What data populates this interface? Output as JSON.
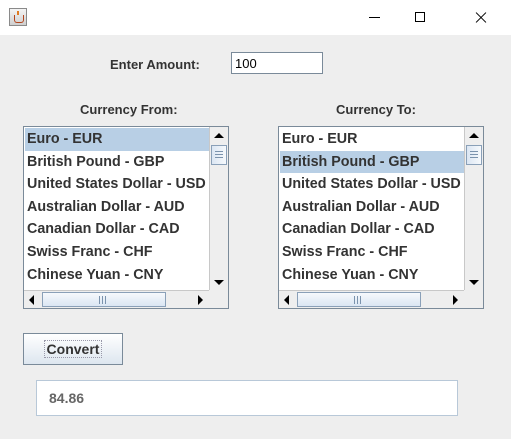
{
  "window": {
    "title": ""
  },
  "form": {
    "amount_label": "Enter Amount:",
    "amount_value": "100",
    "from_label": "Currency From:",
    "to_label": "Currency To:",
    "currencies": [
      "Euro - EUR",
      "British Pound - GBP",
      "United States Dollar - USD",
      "Australian Dollar - AUD",
      "Canadian Dollar - CAD",
      "Swiss Franc - CHF",
      "Chinese Yuan - CNY"
    ],
    "from_selected": "Euro - EUR",
    "to_selected": "British Pound - GBP",
    "convert_label": "Convert",
    "result": "84.86"
  },
  "colors": {
    "selection": "#b8cfe5",
    "background": "#eeeeee"
  }
}
